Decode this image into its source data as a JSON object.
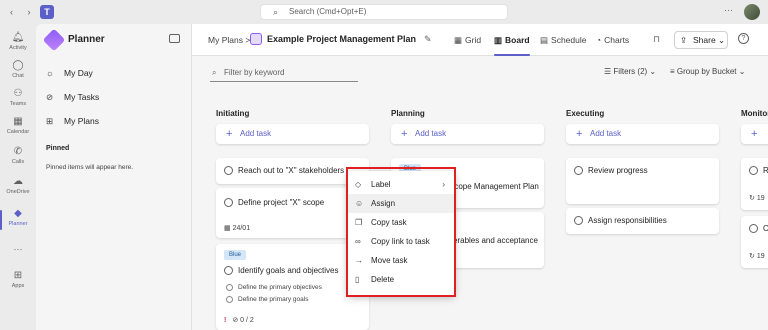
{
  "topbar": {
    "search_placeholder": "Search (Cmd+Opt+E)"
  },
  "rail": {
    "items": [
      {
        "label": "Activity",
        "icon": "bell-icon"
      },
      {
        "label": "Chat",
        "icon": "chat-icon"
      },
      {
        "label": "Teams",
        "icon": "teams-icon"
      },
      {
        "label": "Calendar",
        "icon": "calendar-icon"
      },
      {
        "label": "Calls",
        "icon": "phone-icon"
      },
      {
        "label": "OneDrive",
        "icon": "cloud-icon"
      },
      {
        "label": "Planner",
        "icon": "planner-icon"
      },
      {
        "label": "Apps",
        "icon": "apps-icon"
      }
    ],
    "more": "···"
  },
  "leftpanel": {
    "title": "Planner",
    "items": [
      {
        "label": "My Day",
        "icon": "sun-icon"
      },
      {
        "label": "My Tasks",
        "icon": "check-circle-icon"
      },
      {
        "label": "My Plans",
        "icon": "grid-icon"
      }
    ],
    "pinned_heading": "Pinned",
    "pinned_text": "Pinned items will appear here."
  },
  "header": {
    "breadcrumb": "My Plans  >",
    "plan_name": "Example Project Management Plan",
    "tabs": [
      {
        "label": "Grid",
        "icon": "grid-icon"
      },
      {
        "label": "Board",
        "icon": "board-icon"
      },
      {
        "label": "Schedule",
        "icon": "calendar-icon"
      },
      {
        "label": "Charts",
        "icon": "chart-icon"
      }
    ],
    "share_label": "Share"
  },
  "toolbar": {
    "filter_placeholder": "Filter by keyword",
    "filters_label": "Filters (2)",
    "groupby_label": "Group by Bucket"
  },
  "buckets": [
    {
      "title": "Initiating"
    },
    {
      "title": "Planning"
    },
    {
      "title": "Executing"
    },
    {
      "title": "Monitor"
    }
  ],
  "add_task_label": "Add task",
  "tasks": {
    "t1": "Reach out to \"X\" stakeholders",
    "t2": "Define project \"X\" scope",
    "t2_date": "24/01",
    "t3_label": "Blue",
    "t3": "Identify goals and objectives",
    "t3_sub1": "Define the primary objectives",
    "t3_sub2": "Define the primary goals",
    "t3_progress": "0 / 2",
    "p1_label": "Blue",
    "p1_tail": "Scope Management Plan",
    "p2_tail": "verables and acceptance",
    "e1": "Review progress",
    "e2": "Assign responsibilities",
    "m1": "Re",
    "m1_count": "19",
    "m2": "Co",
    "m2_count": "19"
  },
  "context_menu": {
    "items": [
      {
        "label": "Label",
        "icon": "tag-icon",
        "submenu": true
      },
      {
        "label": "Assign",
        "icon": "assign-icon",
        "hover": true
      },
      {
        "label": "Copy task",
        "icon": "copy-icon"
      },
      {
        "label": "Copy link to task",
        "icon": "link-icon"
      },
      {
        "label": "Move task",
        "icon": "arrow-right-icon"
      },
      {
        "label": "Delete",
        "icon": "trash-icon"
      }
    ]
  },
  "colors": {
    "accent": "#5b5fc7",
    "highlight": "#e02020",
    "label_blue": "#d4e6f7"
  }
}
